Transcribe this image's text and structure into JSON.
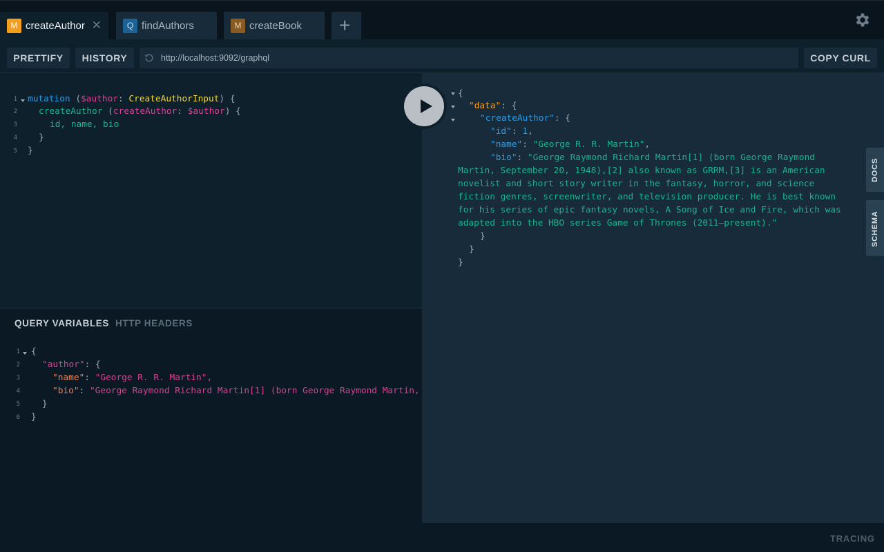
{
  "tabs": [
    {
      "badge": "M",
      "title": "createAuthor",
      "close": "✕",
      "active": true
    },
    {
      "badge": "Q",
      "title": "findAuthors",
      "active": false
    },
    {
      "badge": "M",
      "title": "createBook",
      "active": false
    }
  ],
  "toolbar": {
    "prettify_label": "PRETTIFY",
    "history_label": "HISTORY",
    "endpoint_url": "http://localhost:9092/graphql",
    "copy_curl_label": "COPY CURL"
  },
  "query": {
    "line_numbers": [
      "1",
      "2",
      "3",
      "4",
      "5"
    ],
    "line1": {
      "keyword": "mutation",
      "open_paren": " (",
      "variable": "$author",
      "colon": ": ",
      "type": "CreateAuthorInput",
      "close": ") {"
    },
    "line2": {
      "field": "createAuthor",
      "open_paren": " (",
      "arg": "createAuthor",
      "colon": ": ",
      "variable": "$author",
      "close": ") {"
    },
    "line3": {
      "fields": "id, name, bio"
    },
    "line4": "}",
    "line5": "}"
  },
  "variables_panel": {
    "tab_query_variables": "QUERY VARIABLES",
    "tab_http_headers": "HTTP HEADERS",
    "line_numbers": [
      "1",
      "2",
      "3",
      "4",
      "5",
      "6"
    ],
    "open_brace": "{",
    "author_key": "\"author\"",
    "name_key": "\"name\"",
    "name_value": "\"George R. R. Martin\",",
    "bio_key": "\"bio\"",
    "bio_value": "\"George Raymond Richard Martin[1] (born George Raymond Martin,",
    "inner_close": "}",
    "outer_close": "}"
  },
  "result": {
    "open_brace": "{",
    "data_key": "\"data\"",
    "create_author_key": "\"createAuthor\"",
    "id_key": "\"id\"",
    "id_value": "1",
    "name_key": "\"name\"",
    "name_value": "\"George R. R. Martin\"",
    "bio_key": "\"bio\"",
    "bio_lines": [
      "\"George Raymond Richard Martin[1] (born George Raymond",
      "Martin, September 20, 1948),[2] also known as GRRM,[3] is an American",
      "novelist and short story writer in the fantasy, horror, and science",
      "fiction genres, screenwriter, and television producer. He is best known",
      "for his series of epic fantasy novels, A Song of Ice and Fire, which was",
      "adapted into the HBO series Game of Thrones (2011–present).\""
    ],
    "close1": "}",
    "close2": "}",
    "close3": "}"
  },
  "side_tabs": {
    "docs": "DOCS",
    "schema": "SCHEMA"
  },
  "footer": {
    "tracing_label": "TRACING"
  }
}
